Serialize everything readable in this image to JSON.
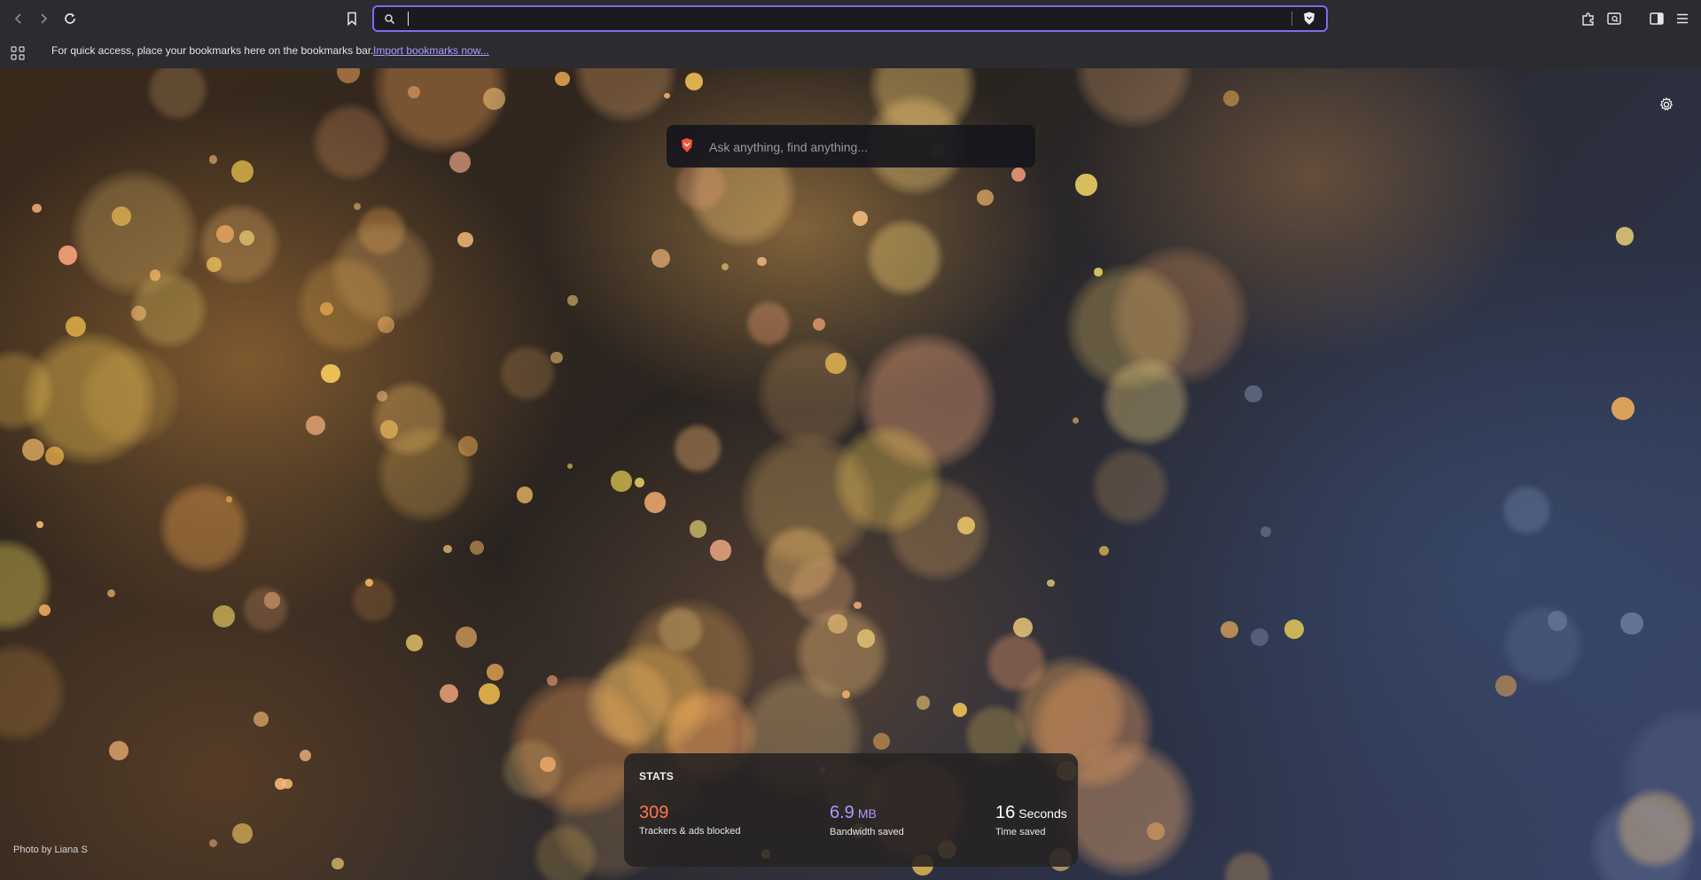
{
  "toolbar": {
    "back_icon": "chevron-left-icon",
    "forward_icon": "chevron-right-icon",
    "reload_icon": "reload-icon",
    "bookmark_icon": "bookmark-icon",
    "extensions_icon": "puzzle-icon",
    "reading_icon": "reading-list-icon",
    "sidebar_icon": "sidebar-icon",
    "menu_icon": "hamburger-menu-icon"
  },
  "address_bar": {
    "value": "",
    "placeholder": "",
    "shield_icon": "brave-shields-icon",
    "accent_color": "#7c6cf2"
  },
  "bookmarks_bar": {
    "apps_icon": "apps-grid-icon",
    "message": "For quick access, place your bookmarks here on the bookmarks bar.",
    "import_link": "Import bookmarks now..."
  },
  "new_tab": {
    "settings_icon": "gear-icon",
    "search": {
      "placeholder": "Ask anything, find anything...",
      "logo_icon": "brave-lion-icon"
    },
    "stats": {
      "title": "STATS",
      "trackers": {
        "value": "309",
        "label": "Trackers & ads blocked",
        "color": "#ff7654"
      },
      "bandwidth": {
        "value": "6.9",
        "unit": "MB",
        "label": "Bandwidth saved",
        "color": "#a99bff"
      },
      "time": {
        "value": "16",
        "unit": "Seconds",
        "label": "Time saved",
        "color": "#ffffff"
      }
    },
    "photo_credit": "Photo by Liana S"
  }
}
